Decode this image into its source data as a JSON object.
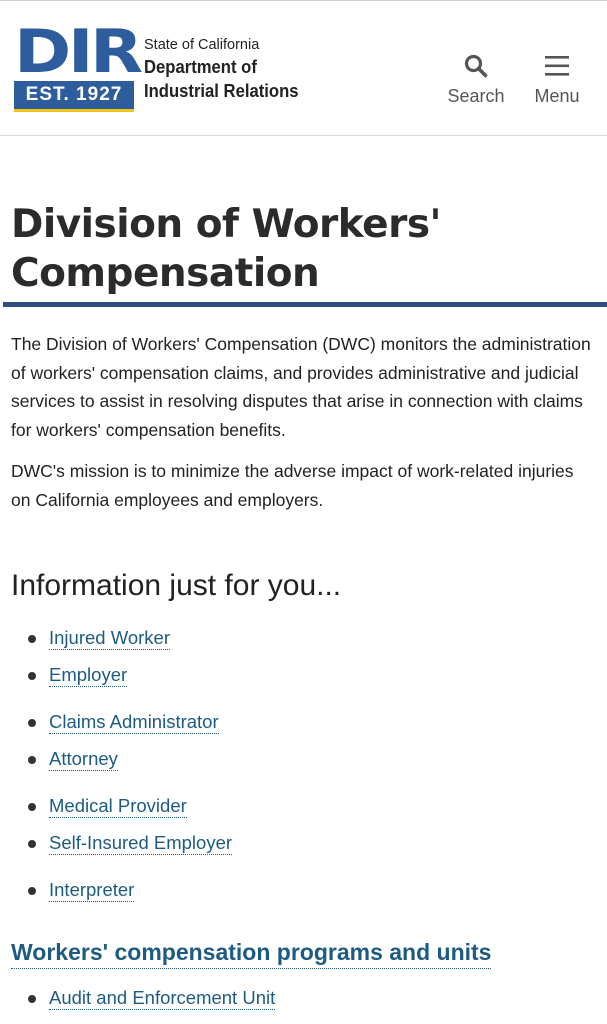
{
  "header": {
    "logo": {
      "mark": "DIR",
      "est": "EST. 1927"
    },
    "agency_state": "State of California",
    "agency_line1": "Department of",
    "agency_line2": "Industrial Relations",
    "search_label": "Search",
    "menu_label": "Menu",
    "search_icon": "search-icon",
    "menu_icon": "hamburger-menu-icon"
  },
  "colors": {
    "brand_blue": "#2e5d9d",
    "accent_yellow": "#f5c314",
    "link": "#1d5b82",
    "heading_rule": "#2d4e7e"
  },
  "main": {
    "title_line1": "Division of Workers'",
    "title_line2": "Compensation",
    "intro_p1": "The Division of Workers' Compensation (DWC) monitors the administration of workers' compensation claims, and provides administrative and judicial services to assist in resolving disputes that arise in connection with claims for workers' compensation benefits.",
    "intro_p2": "DWC's mission is to minimize the adverse impact of work-related injuries on California employees and employers.",
    "info_title": "Information just for you...",
    "links": [
      "Injured Worker",
      "Employer",
      "Claims Administrator",
      "Attorney",
      "Medical Provider",
      "Self-Insured Employer",
      "Interpreter"
    ],
    "programs_title": "Workers' compensation programs and units",
    "units": [
      "Audit and Enforcement Unit"
    ]
  }
}
